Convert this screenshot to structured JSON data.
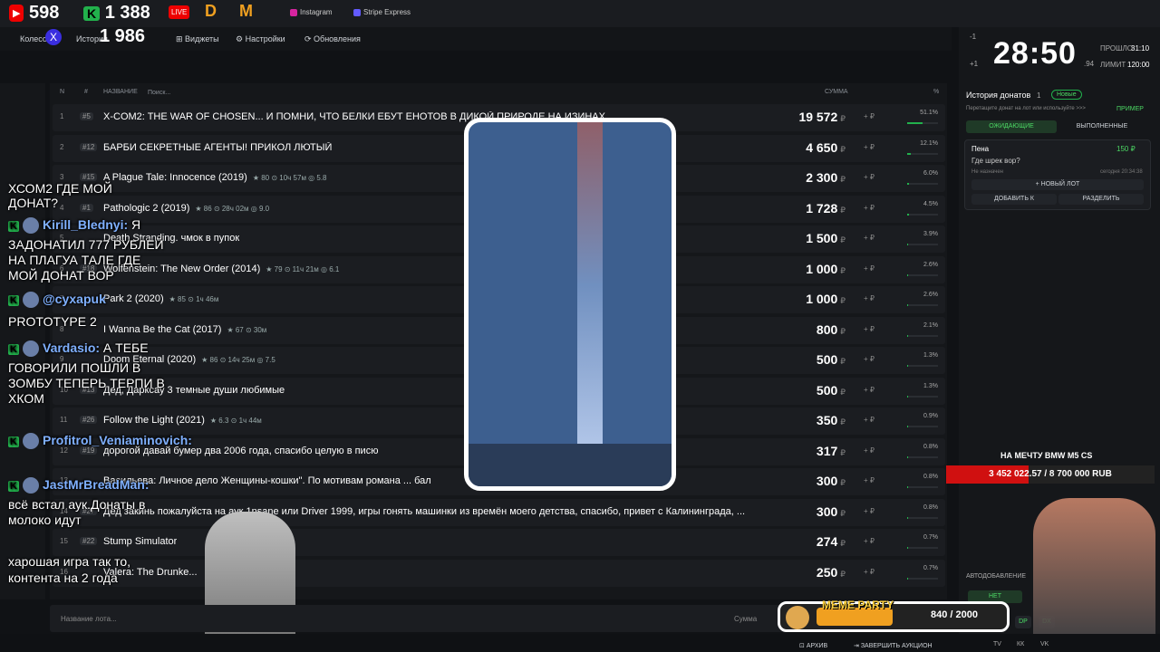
{
  "topbar": {
    "youtube_count": "598",
    "kick_count": "1 388",
    "x_count": "1 986",
    "live_label": "LIVE",
    "items": [
      "Instagram",
      "Stripe Express"
    ]
  },
  "nav": {
    "items": [
      "Колесо",
      "История",
      "Виджеты",
      "Настройки",
      "Обновления"
    ]
  },
  "table": {
    "headers": {
      "n": "N",
      "hash": "#",
      "name": "НАЗВАНИЕ",
      "search": "Поиск...",
      "sum": "СУММА",
      "pct": "%"
    },
    "rows": [
      {
        "n": "1",
        "id": "#5",
        "title": "X-COM2: THE WAR OF CHOSEN... И ПОМНИ, ЧТО БЕЛКИ ЕБУТ ЕНОТОВ В ДИКОЙ ПРИРОДЕ НА ИЗИНАХ",
        "sum": "19 572",
        "pct": "51.1%",
        "fill": 0.511
      },
      {
        "n": "2",
        "id": "#12",
        "title": "БАРБИ СЕКРЕТНЫЕ АГЕНТЫ! ПРИКОЛ ЛЮТЫЙ",
        "sum": "4 650",
        "pct": "12.1%",
        "fill": 0.121
      },
      {
        "n": "3",
        "id": "#15",
        "title": "A Plague Tale: Innocence (2019)",
        "meta": "★ 80 ⊙ 10ч 57м ◎ 5.8",
        "sum": "2 300",
        "pct": "6.0%",
        "fill": 0.06
      },
      {
        "n": "4",
        "id": "#1",
        "title": "Pathologic 2 (2019)",
        "meta": "★ 86 ⊙ 28ч 02м ◎ 9.0",
        "sum": "1 728",
        "pct": "4.5%",
        "fill": 0.045
      },
      {
        "n": "5",
        "id": "",
        "title": "Death Stranding. чмок в пупок",
        "sum": "1 500",
        "pct": "3.9%",
        "fill": 0.039
      },
      {
        "n": "6",
        "id": "#18",
        "title": "Wolfenstein: The New Order (2014)",
        "meta": "★ 79 ⊙ 11ч 21м ◎ 6.1",
        "sum": "1 000",
        "pct": "2.6%",
        "fill": 0.026
      },
      {
        "n": "7",
        "id": "",
        "title": "Park 2 (2020)",
        "meta": "★ 85 ⊙ 1ч 46м",
        "sum": "1 000",
        "pct": "2.6%",
        "fill": 0.026
      },
      {
        "n": "8",
        "id": "",
        "title": "I Wanna Be the Cat (2017)",
        "meta": "★ 67 ⊙ 30м",
        "sum": "800",
        "pct": "2.1%",
        "fill": 0.021
      },
      {
        "n": "9",
        "id": "",
        "title": "Doom Eternal (2020)",
        "meta": "★ 86 ⊙ 14ч 25м ◎ 7.5",
        "sum": "500",
        "pct": "1.3%",
        "fill": 0.013
      },
      {
        "n": "10",
        "id": "#13",
        "title": "Дед, Дарксау 3 темные души любимые",
        "sum": "500",
        "pct": "1.3%",
        "fill": 0.013
      },
      {
        "n": "11",
        "id": "#26",
        "title": "Follow the Light (2021)",
        "meta": "★ 6.3 ⊙ 1ч 44м",
        "sum": "350",
        "pct": "0.9%",
        "fill": 0.009
      },
      {
        "n": "12",
        "id": "#19",
        "title": "дорогой давай бумер два 2006 года, спасибо целую в писю",
        "sum": "317",
        "pct": "0.8%",
        "fill": 0.008
      },
      {
        "n": "13",
        "id": "",
        "title": "Васильева: Личное дело Женщины-кошки\". По мотивам романа ... бал",
        "sum": "300",
        "pct": "0.8%",
        "fill": 0.008
      },
      {
        "n": "14",
        "id": "#27",
        "title": "Дед закинь пожалуйста на аук 1nsane или Driver 1999, игры гонять машинки из времён моего детства, спасибо, привет с Калининграда, ...",
        "sum": "300",
        "pct": "0.8%",
        "fill": 0.008
      },
      {
        "n": "15",
        "id": "#22",
        "title": "Stump Simulator",
        "sum": "274",
        "pct": "0.7%",
        "fill": 0.007
      },
      {
        "n": "16",
        "id": "",
        "title": "Valera: The Drunke...",
        "sum": "250",
        "pct": "0.7%",
        "fill": 0.007
      }
    ],
    "currency": "₽",
    "plus": "+ ₽"
  },
  "chat": [
    {
      "text": "ХСОМ2 ГДЕ МОЙ"
    },
    {
      "text": "ДОНАТ?"
    },
    {
      "user": "Kirill_Blednyi:",
      "text": "Я"
    },
    {
      "text": "ЗАДОНАТИЛ 777 РУБЛЕЙ"
    },
    {
      "text": "НА ПЛАГУА ТАЛЕ ГДЕ"
    },
    {
      "text": "МОЙ ДОНАТ ВОР"
    },
    {
      "user": "@сухарuk",
      "text": ""
    },
    {
      "text": "PROTOTYPE 2"
    },
    {
      "user": "Vardasio:",
      "text": "А ТЕБЕ"
    },
    {
      "text": "ГОВОРИЛИ ПОШЛИ В"
    },
    {
      "text": "ЗОМБУ ТЕПЕРЬ ТЕРПИ В"
    },
    {
      "text": "ХКОМ"
    },
    {
      "user": "Profitrol_Veniaminovich:",
      "text": ""
    },
    {
      "user": "JastMrBreadMan:",
      "text": ""
    },
    {
      "text": "всё встал аук.Донаты в"
    },
    {
      "text": "молоко идут"
    },
    {
      "text": "харошая игра так то,"
    },
    {
      "text": "контента на 2 года"
    }
  ],
  "right": {
    "timer": "28:50",
    "timer_ms": ".94",
    "passed_label": "ПРОШЛО",
    "passed_value": "31:10",
    "limit_label": "ЛИМИТ",
    "limit_value": "120:00",
    "timer_controls": [
      "-1",
      "+1"
    ],
    "history_title": "История донатов",
    "history_count": "1",
    "new_label": "Новые",
    "example_label": "ПРИМЕР",
    "drag_hint": "Перетащите донат на лот или используйте >>>",
    "tab_waiting": "ОЖИДАЮЩИЕ",
    "tab_done": "ВЫПОЛНЕННЫЕ",
    "donor": "Пена",
    "donor_amount": "150 ₽",
    "donor_msg": "Где шрек вор?",
    "not_assigned": "Не назначен",
    "time": "сегодня 20:34:38",
    "new_lot": "+ НОВЫЙ ЛОТ",
    "add_to": "ДОБАВИТЬ К",
    "split": "РАЗДЕЛИТЬ",
    "auto_label": "АВТОДОБАВЛЕНИЕ",
    "no_label": "НЕТ",
    "dp": "DP",
    "dx": "DX",
    "footer": [
      "TV",
      "КК",
      "VK"
    ]
  },
  "goal": {
    "label": "НА МЕЧТУ BMW M5 CS",
    "text": "3 452 022.57 / 8 700 000 RUB",
    "fraction": 0.397
  },
  "meme": {
    "label": "MEME PARTY",
    "progress": "840 / 2000",
    "fraction": 0.42
  },
  "bottom": {
    "lot_placeholder": "Название лота...",
    "sum_placeholder": "Сумма",
    "archive": "АРХИВ",
    "finish": "ЗАВЕРШИТЬ АУКЦИОН"
  },
  "colors": {
    "accent": "#22b14c",
    "red": "#d01010",
    "gold": "#f0a020"
  }
}
